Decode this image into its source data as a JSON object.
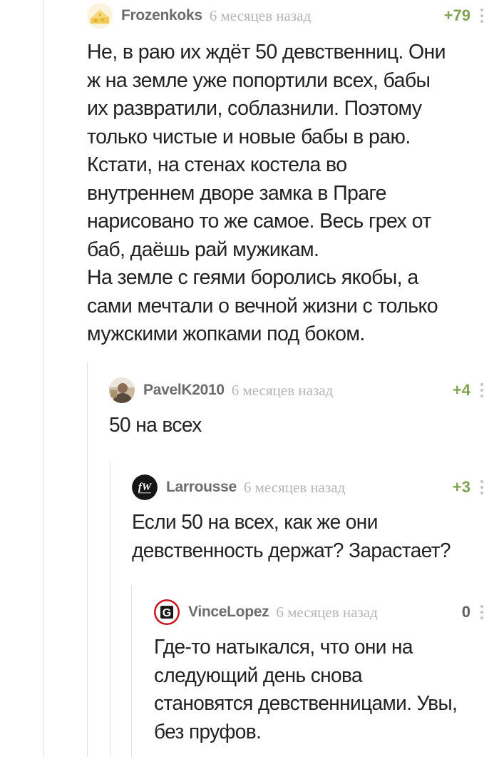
{
  "comments": [
    {
      "author": "Frozenkoks",
      "time": "6 месяцев назад",
      "rating": "+79",
      "text": "Не, в раю их ждёт 50 девственниц. Они\nж на земле уже попортили всех, бабы\nих развратили, соблазнили. Поэтому\nтолько чистые и новые бабы в раю.\nКстати, на стенах костела во\nвнутреннем дворе замка в Праге\nнарисовано то же самое. Весь грех от\nбаб, даёшь рай мужикам.\nНа земле с геями боролись якобы, а\nсами мечтали о вечной жизни с только\nмужскими жопками под боком."
    },
    {
      "author": "PavelK2010",
      "time": "6 месяцев назад",
      "rating": "+4",
      "text": "50 на всех"
    },
    {
      "author": "Larrousse",
      "time": "6 месяцев назад",
      "rating": "+3",
      "text": "Если 50 на всех, как же они\nдевственность держат? Зарастает?",
      "avatar_text": "fW"
    },
    {
      "author": "VinceLopez",
      "time": "6 месяцев назад",
      "rating": "0",
      "text": "Где-то натыкался, что они на\nследующий день снова\nстановятся девственницами. Увы,\nбез пруфов.",
      "avatar_text": "G"
    }
  ],
  "colors": {
    "positive_rating": "#7fa350",
    "neutral_rating": "#5f5f5f",
    "author": "#6c6c6c",
    "time": "#b5b5b5",
    "thread_line": "#e2e2e2"
  }
}
